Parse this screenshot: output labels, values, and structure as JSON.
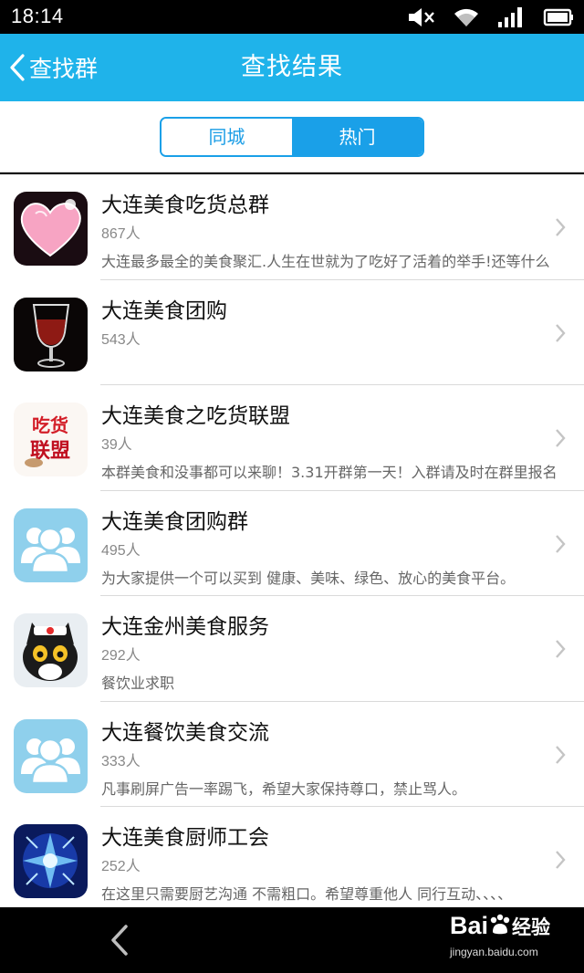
{
  "status_bar": {
    "time": "18:14",
    "icons": [
      "mute-icon",
      "wifi-icon",
      "signal-icon",
      "battery-icon"
    ]
  },
  "header": {
    "back_label": "查找群",
    "title": "查找结果"
  },
  "segment": {
    "tabs": [
      {
        "label": "同城",
        "selected": false
      },
      {
        "label": "热门",
        "selected": true
      }
    ]
  },
  "groups": [
    {
      "name": "大连美食吃货总群",
      "count": "867人",
      "desc": "大连最多最全的美食聚汇.人生在世就为了吃好了活着的举手!还等什么",
      "avatar": "heart"
    },
    {
      "name": "大连美食团购",
      "count": "543人",
      "desc": "",
      "avatar": "wine"
    },
    {
      "name": "大连美食之吃货联盟",
      "count": "39人",
      "desc": "本群美食和没事都可以来聊！3.31开群第一天！入群请及时在群里报名",
      "avatar": "text"
    },
    {
      "name": "大连美食团购群",
      "count": "495人",
      "desc": "为大家提供一个可以买到 健康、美味、绿色、放心的美食平台。",
      "avatar": "default"
    },
    {
      "name": "大连金州美食服务",
      "count": "292人",
      "desc": "餐饮业求职",
      "avatar": "cat"
    },
    {
      "name": "大连餐饮美食交流",
      "count": "333人",
      "desc": "凡事刷屏广告一率踢飞，希望大家保持尊口，禁止骂人。",
      "avatar": "default"
    },
    {
      "name": "大连美食厨师工会",
      "count": "252人",
      "desc": "在这里只需要厨艺沟通 不需粗口。希望尊重他人 同行互动、、、、",
      "avatar": "blue"
    }
  ],
  "avatar_text": {
    "line1": "吃货",
    "line2": "联盟"
  },
  "watermark": {
    "brand": "Bai",
    "brand2": "经验",
    "url": "jingyan.baidu.com"
  },
  "colors": {
    "header": "#1fb3ea",
    "accent": "#1aa0e8"
  }
}
